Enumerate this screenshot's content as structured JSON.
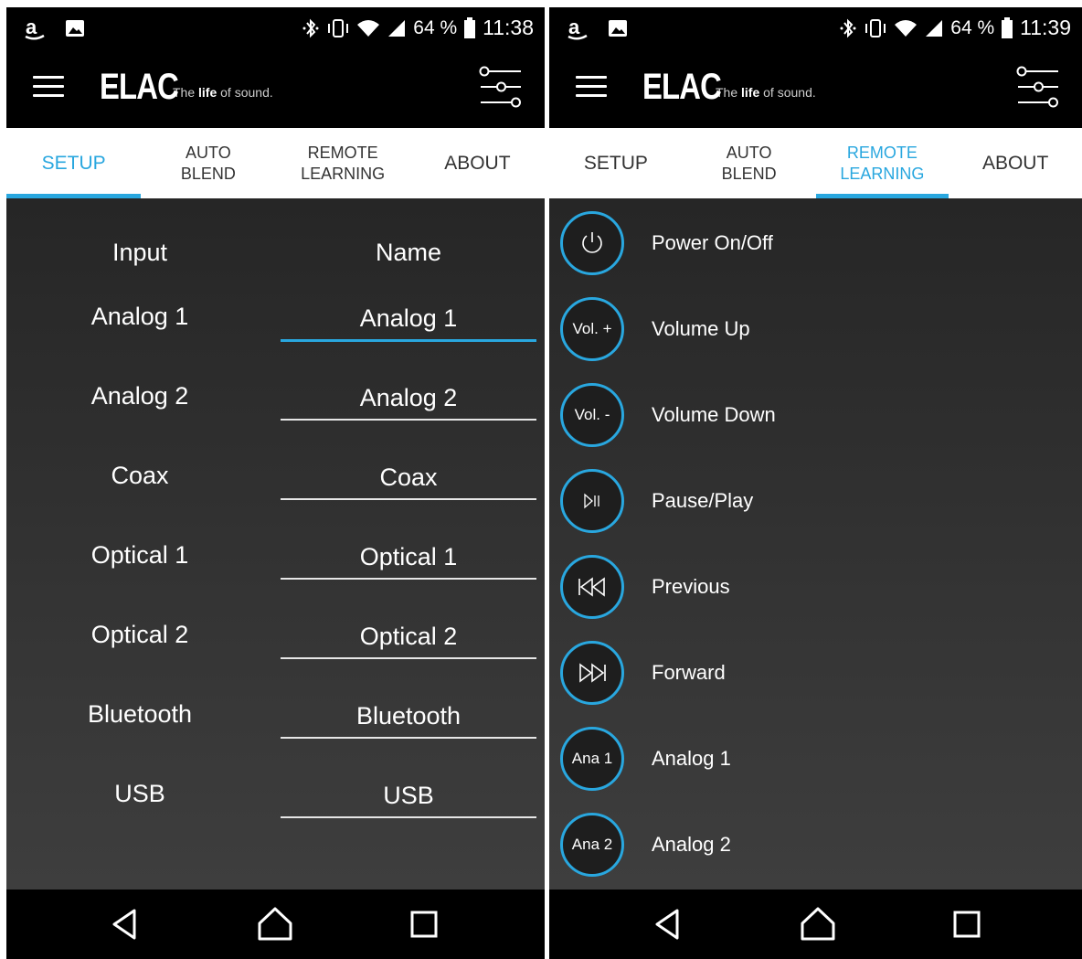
{
  "status_left": {
    "time": "11:38",
    "battery": "64 %"
  },
  "status_right": {
    "time": "11:39",
    "battery": "64 %"
  },
  "brand": {
    "logo": "ELAC",
    "tagline_pre": "The ",
    "tagline_bold": "life",
    "tagline_post": " of sound."
  },
  "tabs": [
    {
      "label": "SETUP"
    },
    {
      "label": "AUTO\nBLEND"
    },
    {
      "label": "REMOTE\nLEARNING"
    },
    {
      "label": "ABOUT"
    }
  ],
  "setup": {
    "input_header": "Input",
    "name_header": "Name",
    "rows": [
      {
        "input": "Analog 1",
        "name": "Analog 1"
      },
      {
        "input": "Analog 2",
        "name": "Analog 2"
      },
      {
        "input": "Coax",
        "name": "Coax"
      },
      {
        "input": "Optical 1",
        "name": "Optical 1"
      },
      {
        "input": "Optical 2",
        "name": "Optical 2"
      },
      {
        "input": "Bluetooth",
        "name": "Bluetooth"
      },
      {
        "input": "USB",
        "name": "USB"
      }
    ]
  },
  "remote": {
    "items": [
      {
        "button": "",
        "icon": "power-icon",
        "label": "Power On/Off"
      },
      {
        "button": "Vol. +",
        "label": "Volume Up"
      },
      {
        "button": "Vol. -",
        "label": "Volume Down"
      },
      {
        "button": "",
        "icon": "play-pause-icon",
        "label": "Pause/Play"
      },
      {
        "button": "",
        "icon": "previous-icon",
        "label": "Previous"
      },
      {
        "button": "",
        "icon": "forward-icon",
        "label": "Forward"
      },
      {
        "button": "Ana 1",
        "label": "Analog 1"
      },
      {
        "button": "Ana 2",
        "label": "Analog 2"
      }
    ]
  },
  "colors": {
    "accent": "#29a7df",
    "content_bg": "#2a2a2a",
    "bar_bg": "#000000"
  }
}
